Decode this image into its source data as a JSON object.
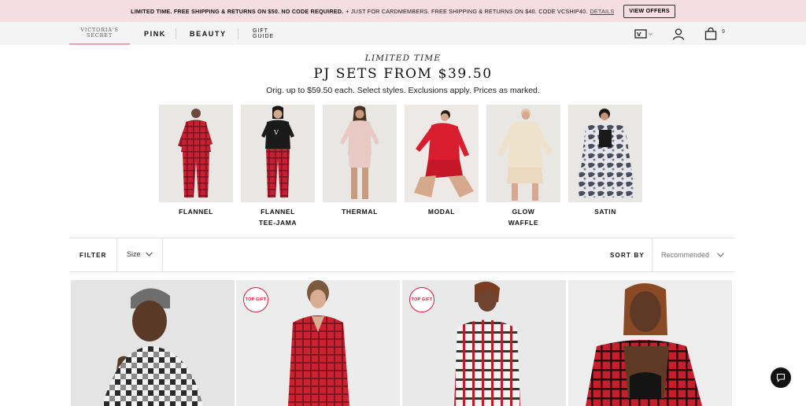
{
  "promo": {
    "part1": "LIMITED TIME. FREE SHIPPING & RETURNS ON $50. NO CODE REQUIRED.",
    "part2": "+ JUST FOR CARDMEMBERS. FREE SHIPPING & RETURNS ON $40. CODE VCSHIP40.",
    "details_label": "DETAILS",
    "offers_button": "VIEW OFFERS"
  },
  "header": {
    "brand_line1": "VICTORIA'S",
    "brand_line2": "SECRET",
    "nav": [
      "PINK",
      "BEAUTY"
    ],
    "gift_line1": "GIFT",
    "gift_line2": "GUIDE",
    "cart_count": "9",
    "icons": [
      "vs-card-icon",
      "account-icon",
      "shopping-bag-icon"
    ]
  },
  "hero": {
    "kicker": "LIMITED TIME",
    "headline": "PJ SETS FROM $39.50",
    "subline": "Orig. up to $59.50 each. Select styles. Exclusions apply. Prices as marked."
  },
  "categories": [
    {
      "label": "FLANNEL",
      "label2": ""
    },
    {
      "label": "FLANNEL",
      "label2": "TEE-JAMA"
    },
    {
      "label": "THERMAL",
      "label2": ""
    },
    {
      "label": "MODAL",
      "label2": ""
    },
    {
      "label": "GLOW",
      "label2": "WAFFLE"
    },
    {
      "label": "SATIN",
      "label2": ""
    }
  ],
  "filters": {
    "filter_label": "FILTER",
    "size_label": "Size",
    "sort_by_label": "SORT BY",
    "sort_value": "Recommended"
  },
  "products": [
    {
      "badge": ""
    },
    {
      "badge": "TOP GIFT"
    },
    {
      "badge": "TOP GIFT"
    },
    {
      "badge": ""
    }
  ],
  "colors": {
    "promo_bg": "#f6dde2",
    "accent_red": "#d41f3a",
    "nav_underline": "#e8a1b1",
    "flannel_red": "#c8202f"
  }
}
